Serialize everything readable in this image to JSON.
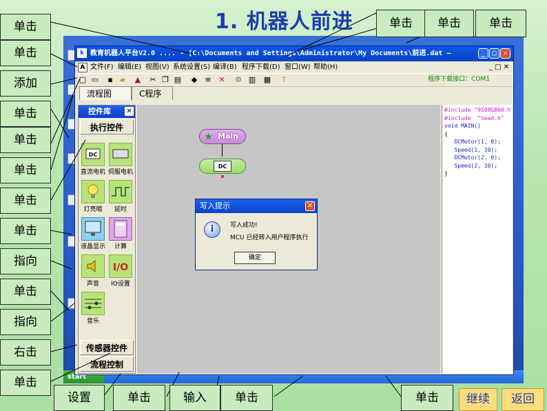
{
  "slide": {
    "title": "1. 机器人前进"
  },
  "app": {
    "icon_text": "k",
    "title": "教育机器人平台V2.0 .... - [C:\\Documents and Settings\\Administrator\\My Documents\\前进.dat —",
    "window_buttons": [
      "_",
      "□",
      "✕"
    ],
    "menu_icon_text": "A",
    "menu": [
      "文件(F)",
      "编辑(E)",
      "视图(V)",
      "系统设置(S)",
      "编译(B)",
      "程序下载(D)",
      "窗口(W)",
      "帮助(H)"
    ],
    "mdi_buttons": "_ □ ✕",
    "toolbar_icons": [
      "new-icon",
      "open-icon",
      "save-icon",
      "folder-icon",
      "export-icon",
      "cut-icon",
      "copy-icon",
      "paste-icon",
      "tool-icon",
      "list-icon",
      "delete-icon",
      "compile-icon",
      "document-icon",
      "download-icon",
      "help-icon"
    ],
    "port_label": "程序下载接口：COM1",
    "tabs": [
      "流程图",
      "C程序"
    ],
    "panel": {
      "title": "控件库",
      "close": "✕",
      "category_top": "执行控件",
      "controls": [
        "直流电机",
        "伺服电机",
        "灯亮暗",
        "延时",
        "液晶显示",
        "计算",
        "声音",
        "IO设置",
        "音乐"
      ],
      "category_sensor": "传感器控件",
      "category_flow": "流程控制"
    },
    "flow": {
      "main_label": "Main",
      "dc_label": "DC"
    },
    "code_lines": [
      "#include \"9S08GB60.h\"",
      "#include  \"head.h\"",
      "void MAIN()",
      "{",
      "   DCMotor(1, 0);",
      "   Speed(1, 10);",
      "   DCMotor(2, 0);",
      "   Speed(2, 10);",
      "}"
    ],
    "code_colors": [
      "#d01ad0",
      "#d01ad0",
      "#1a1ad8",
      "#000000",
      "#1a1ad8",
      "#1a1ad8",
      "#1a1ad8",
      "#1a1ad8",
      "#000000"
    ],
    "dialog": {
      "title": "写入提示",
      "close": "✕",
      "icon": "i",
      "line1": "写入成功!",
      "line2": "MCU 已经转入用户程序执行",
      "ok": "确定"
    },
    "start_label": "start"
  },
  "callouts": {
    "left": [
      "单击",
      "单击",
      "添加",
      "单击",
      "单击",
      "单击",
      "单击",
      "单击",
      "指向",
      "单击",
      "指向",
      "右击",
      "单击"
    ],
    "top": [
      "单击",
      "单击",
      "单击"
    ],
    "bottom": [
      "设置",
      "单击",
      "输入",
      "单击",
      "单击"
    ]
  },
  "nav": {
    "continue": "继续",
    "back": "返回"
  }
}
